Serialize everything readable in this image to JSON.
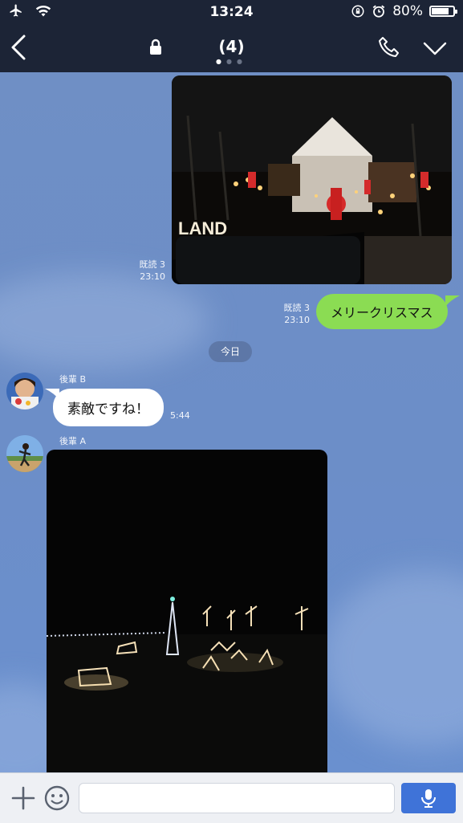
{
  "status_bar": {
    "time": "13:24",
    "battery": "80%",
    "battery_level": 0.8
  },
  "header": {
    "title": "(4)",
    "page_indicator_count": 3,
    "active_page": 1
  },
  "messages": [
    {
      "type": "image",
      "side": "right",
      "read_label": "既読 3",
      "time": "23:10",
      "image_desc_icon": "christmas-house-lights-photo"
    },
    {
      "type": "text",
      "side": "right",
      "text": "メリークリスマス",
      "read_label": "既読 3",
      "time": "23:10"
    },
    {
      "type": "date",
      "text": "今日"
    },
    {
      "type": "text",
      "side": "left",
      "sender": "後輩 B",
      "text": "素敵ですね！",
      "time": "5:44"
    },
    {
      "type": "image",
      "side": "left",
      "sender": "後輩 A",
      "image_desc_icon": "garden-light-display-photo"
    }
  ],
  "input": {
    "placeholder": "",
    "value": ""
  },
  "icons": {
    "airplane": "airplane-icon",
    "wifi": "wifi-icon",
    "rotation_lock": "rotation-lock-icon",
    "alarm": "alarm-icon",
    "back": "back-chevron-icon",
    "lock": "lock-icon",
    "phone": "phone-icon",
    "menu": "chevron-down-icon",
    "plus": "plus-icon",
    "emoji": "emoji-icon",
    "mic": "microphone-icon"
  },
  "colors": {
    "header_bg": "#1c2436",
    "chat_bg": "#6d8fc7",
    "sent_bubble": "#8bdc53",
    "mic_button": "#3f73d8"
  }
}
